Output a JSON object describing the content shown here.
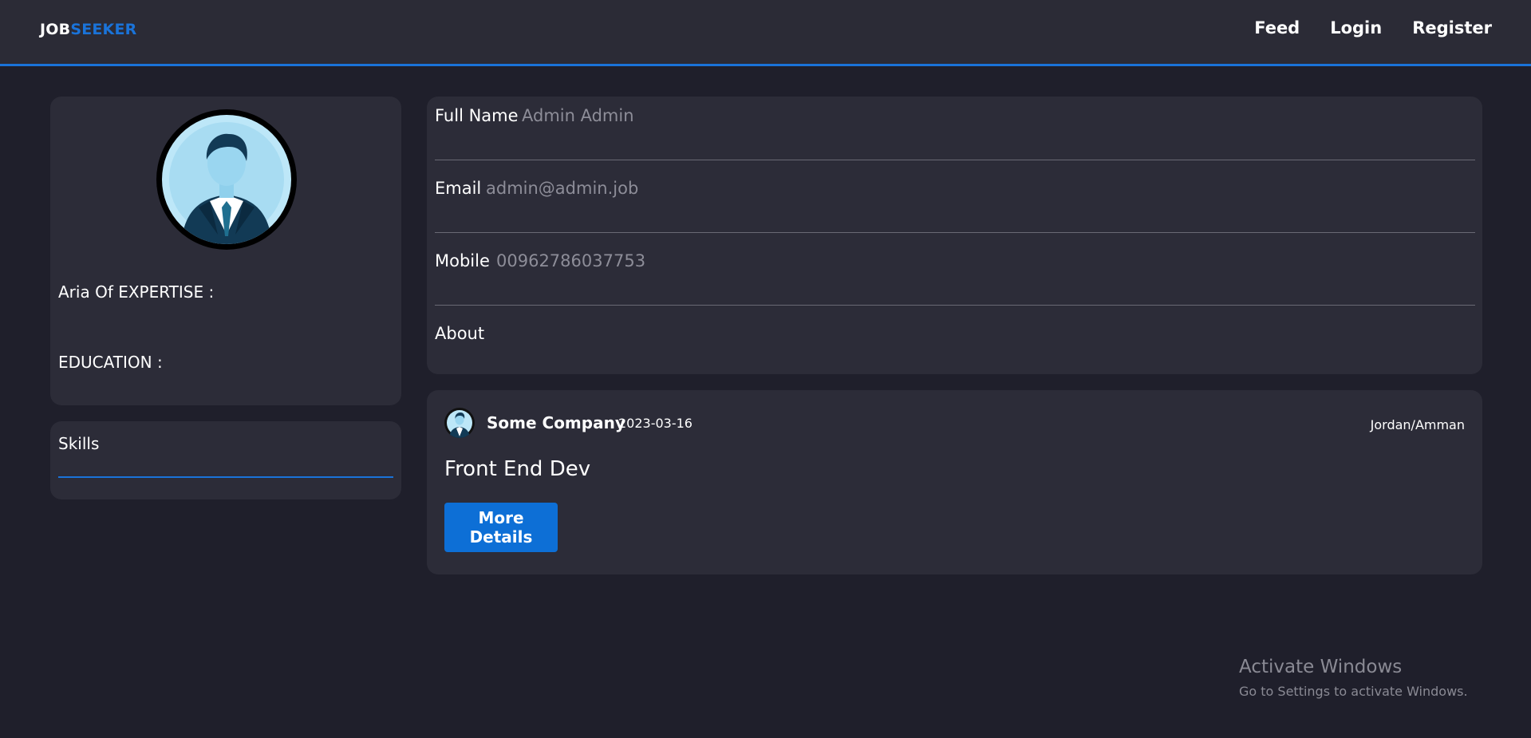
{
  "navbar": {
    "brand_part1": "JOB",
    "brand_part2": "SEEKER",
    "links": [
      {
        "label": "Feed"
      },
      {
        "label": "Login"
      },
      {
        "label": "Register"
      }
    ]
  },
  "profile": {
    "avatar": "user-avatar-icon",
    "expertise_label": "Aria Of EXPERTISE :",
    "education_label": "EDUCATION :"
  },
  "skills": {
    "title": "Skills"
  },
  "info": {
    "full_name_label": "Full Name",
    "full_name_value": "Admin Admin",
    "email_label": "Email",
    "email_value": "admin@admin.job",
    "mobile_label": "Mobile",
    "mobile_value": "00962786037753",
    "about_label": "About"
  },
  "job": {
    "company": "Some Company",
    "date": "2023-03-16",
    "location": "Jordan/Amman",
    "title": "Front End Dev",
    "button_label": "More Details"
  },
  "watermark": {
    "line1": "Activate Windows",
    "line2": "Go to Settings to activate Windows."
  },
  "colors": {
    "accent": "#1a73d9",
    "background": "#1f1f2b",
    "card": "#2c2c38",
    "muted_text": "#8d8d98"
  }
}
